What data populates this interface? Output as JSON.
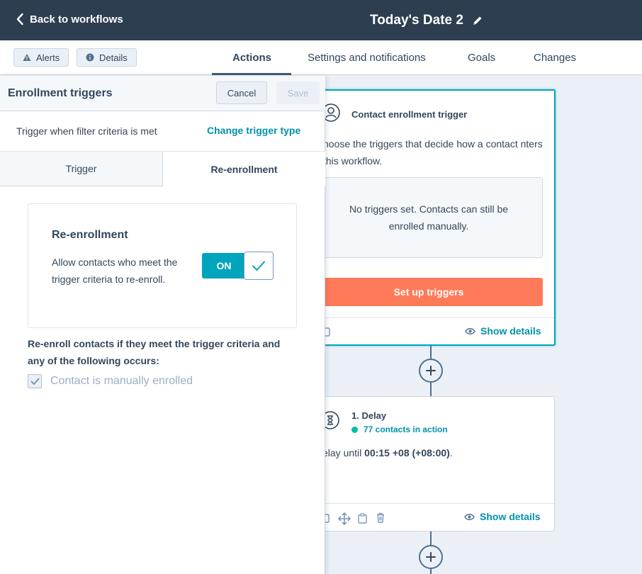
{
  "header": {
    "back_label": "Back to workflows",
    "title": "Today's Date 2"
  },
  "toolbar": {
    "alerts_label": "Alerts",
    "details_label": "Details",
    "tabs": [
      {
        "label": "Actions",
        "active": true
      },
      {
        "label": "Settings and notifications",
        "active": false
      },
      {
        "label": "Goals",
        "active": false
      },
      {
        "label": "Changes",
        "active": false
      }
    ]
  },
  "panel": {
    "title": "Enrollment triggers",
    "cancel_label": "Cancel",
    "save_label": "Save",
    "trigger_text": "Trigger when filter criteria is met",
    "change_trigger_label": "Change trigger type",
    "subtabs": [
      {
        "label": "Trigger",
        "active": false
      },
      {
        "label": "Re-enrollment",
        "active": true
      }
    ],
    "reenrollment": {
      "title": "Re-enrollment",
      "description": "Allow contacts who meet the trigger criteria to re-enroll.",
      "toggle_label": "ON",
      "toggle_on": true
    },
    "condition_text": "Re-enroll contacts if they meet the trigger criteria and any of the following occurs:",
    "checkbox_label": "Contact is manually enrolled",
    "checkbox_checked": true
  },
  "canvas": {
    "trigger_card": {
      "title": "Contact enrollment trigger",
      "description": "hoose the triggers that decide how a contact nters this workflow.",
      "empty_text": "No triggers set. Contacts can still be enrolled manually.",
      "cta_label": "Set up triggers",
      "show_details": "Show details"
    },
    "delay_card": {
      "title": "1. Delay",
      "status": "77 contacts in action",
      "text_prefix": "elay until ",
      "text_bold": "00:15 +08 (+08:00)",
      "text_suffix": ".",
      "show_details": "Show details"
    }
  },
  "colors": {
    "header_bg": "#2d3e50",
    "accent": "#00a4bd",
    "link": "#0091ae",
    "cta": "#ff7a59",
    "status_dot": "#00bda5"
  }
}
